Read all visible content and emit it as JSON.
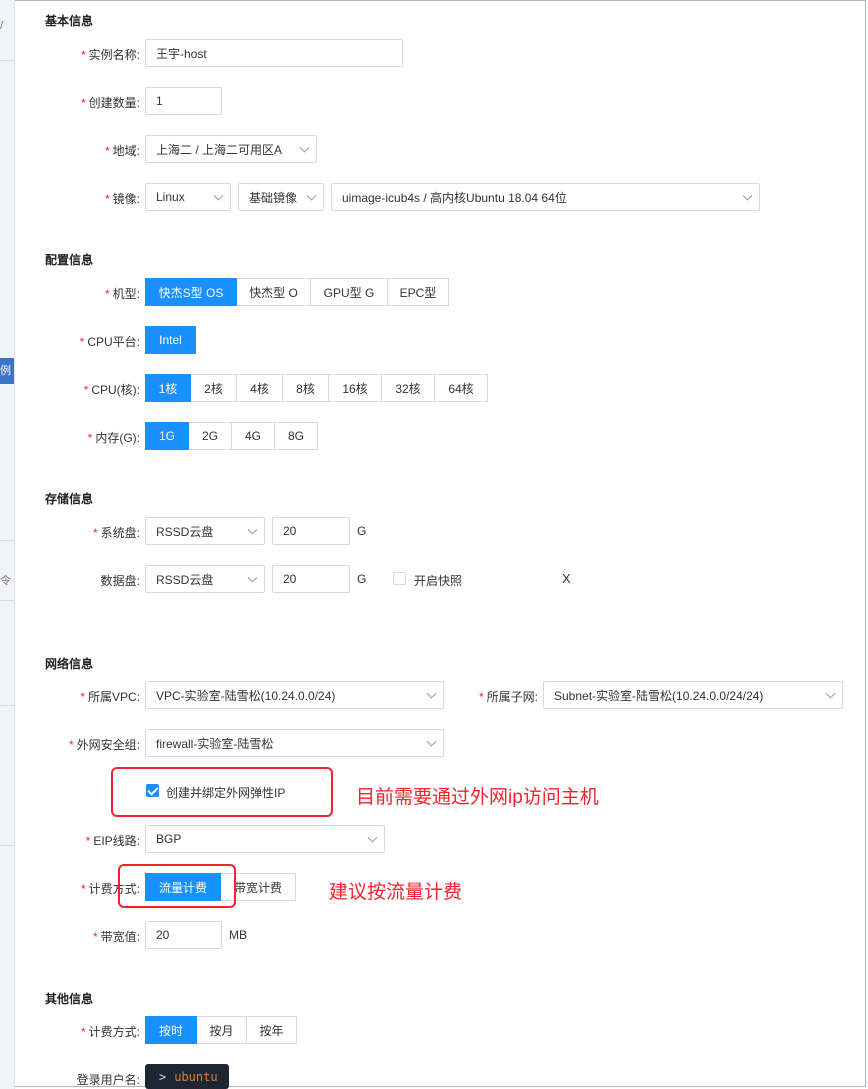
{
  "left_strip": {
    "top_char": "/",
    "mid_char": "例",
    "low_char": "令"
  },
  "sections": {
    "basic": "基本信息",
    "config": "配置信息",
    "storage": "存储信息",
    "network": "网络信息",
    "other": "其他信息"
  },
  "basic": {
    "instance_name": {
      "label": "实例名称:",
      "value": "王宇-host"
    },
    "count": {
      "label": "创建数量:",
      "value": "1"
    },
    "region": {
      "label": "地域:",
      "value": "上海二 / 上海二可用区A"
    },
    "image": {
      "label": "镜像:",
      "os": "Linux",
      "type": "基础镜像",
      "name": "uimage-icub4s / 高内核Ubuntu 18.04 64位"
    }
  },
  "config": {
    "machine": {
      "label": "机型:",
      "options": [
        "快杰S型 OS",
        "快杰型 O",
        "GPU型 G",
        "EPC型"
      ],
      "selected": 0
    },
    "cpu_platform": {
      "label": "CPU平台:",
      "options": [
        "Intel"
      ],
      "selected": 0
    },
    "cpu": {
      "label": "CPU(核):",
      "options": [
        "1核",
        "2核",
        "4核",
        "8核",
        "16核",
        "32核",
        "64核"
      ],
      "selected": 0
    },
    "memory": {
      "label": "内存(G):",
      "options": [
        "1G",
        "2G",
        "4G",
        "8G"
      ],
      "selected": 0
    }
  },
  "storage": {
    "system_disk": {
      "label": "系统盘:",
      "type": "RSSD云盘",
      "size": "20",
      "unit": "G"
    },
    "data_disk": {
      "label": "数据盘:",
      "type": "RSSD云盘",
      "size": "20",
      "unit": "G",
      "snapshot_label": "开启快照",
      "snapshot_checked": false,
      "remove": "X"
    }
  },
  "network": {
    "vpc": {
      "label": "所属VPC:",
      "value": "VPC-实验室-陆雪松(10.24.0.0/24)"
    },
    "subnet": {
      "label": "所属子网:",
      "value": "Subnet-实验室-陆雪松(10.24.0.0/24/24)"
    },
    "firewall": {
      "label": "外网安全组:",
      "value": "firewall-实验室-陆雪松"
    },
    "eip": {
      "checkbox_label": "创建并绑定外网弹性IP",
      "checked": true
    },
    "eip_line": {
      "label": "EIP线路:",
      "value": "BGP"
    },
    "billing": {
      "label": "计费方式:",
      "options": [
        "流量计费",
        "带宽计费"
      ],
      "selected": 0
    },
    "bandwidth": {
      "label": "带宽值:",
      "value": "20",
      "unit": "MB"
    }
  },
  "other": {
    "billing": {
      "label": "计费方式:",
      "options": [
        "按时",
        "按月",
        "按年"
      ],
      "selected": 0
    },
    "login_user": {
      "label": "登录用户名:",
      "prompt": ">",
      "value": "ubuntu"
    }
  },
  "annotations": {
    "eip_note": "目前需要通过外网ip访问主机",
    "billing_note": "建议按流量计费"
  },
  "colors": {
    "primary": "#1890ff",
    "required": "#f5222d",
    "annotation": "#f5222d"
  }
}
